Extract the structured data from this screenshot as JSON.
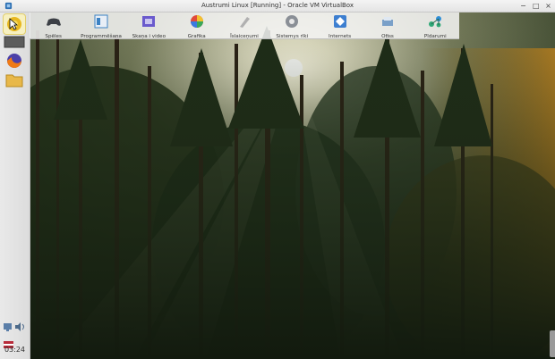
{
  "window": {
    "title": "Austrumi Linux [Running] - Oracle VM VirtualBox",
    "icon": "virtualbox-icon",
    "controls": [
      "minimize",
      "maximize",
      "close"
    ]
  },
  "menu_categories": [
    {
      "label": "Spēles",
      "icon": "gamepad-icon",
      "color": "#3b3f45"
    },
    {
      "label": "Programmēšana",
      "icon": "code-editor-icon",
      "color": "#3b82c4"
    },
    {
      "label": "Skaņa i video",
      "icon": "film-icon",
      "color": "#6a5acd"
    },
    {
      "label": "Grafika",
      "icon": "color-wheel-icon",
      "color": "#e04a3a"
    },
    {
      "label": "Īslaiceņumi",
      "icon": "pen-tool-icon",
      "color": "#b0b0b0"
    },
    {
      "label": "Sistemys rīki",
      "icon": "gear-icon",
      "color": "#8a8f96"
    },
    {
      "label": "Internets",
      "icon": "globe-network-icon",
      "color": "#3d7fd0"
    },
    {
      "label": "Ofiss",
      "icon": "printer-icon",
      "color": "#7aa0c8"
    },
    {
      "label": "Pīdarumi",
      "icon": "molecule-icon",
      "color": "#2fa877"
    }
  ],
  "left_panel": {
    "launchers": [
      {
        "name": "start-menu",
        "icon": "austrumi-logo-icon"
      },
      {
        "name": "terminal",
        "icon": "terminal-icon"
      },
      {
        "name": "firefox",
        "icon": "firefox-icon"
      },
      {
        "name": "file-manager",
        "icon": "folder-icon"
      }
    ],
    "tray": [
      "network-icon",
      "volume-icon",
      "keyboard-layout-flag-icon"
    ],
    "clock": "03:24"
  }
}
